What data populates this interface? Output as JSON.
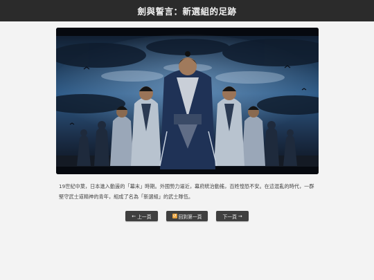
{
  "page": {
    "title": "劍與誓言：新選組的足跡"
  },
  "hero": {
    "alt": "新選組武士群像"
  },
  "story": {
    "text": "19世紀中葉，日本進入動盪的「幕末」時期。外國勢力逼近，幕府統治動搖，百姓惶恐不安。在這混亂的時代，一群堅守武士道精神的青年，組成了名為「新選組」的武士隊伍。"
  },
  "nav": {
    "prev_label": "上一頁",
    "home_label": "回到第一頁",
    "next_label": "下一頁"
  },
  "colors": {
    "topbar": "#2b2b2b",
    "button": "#3f3f3f",
    "background": "#f3f3f3"
  }
}
